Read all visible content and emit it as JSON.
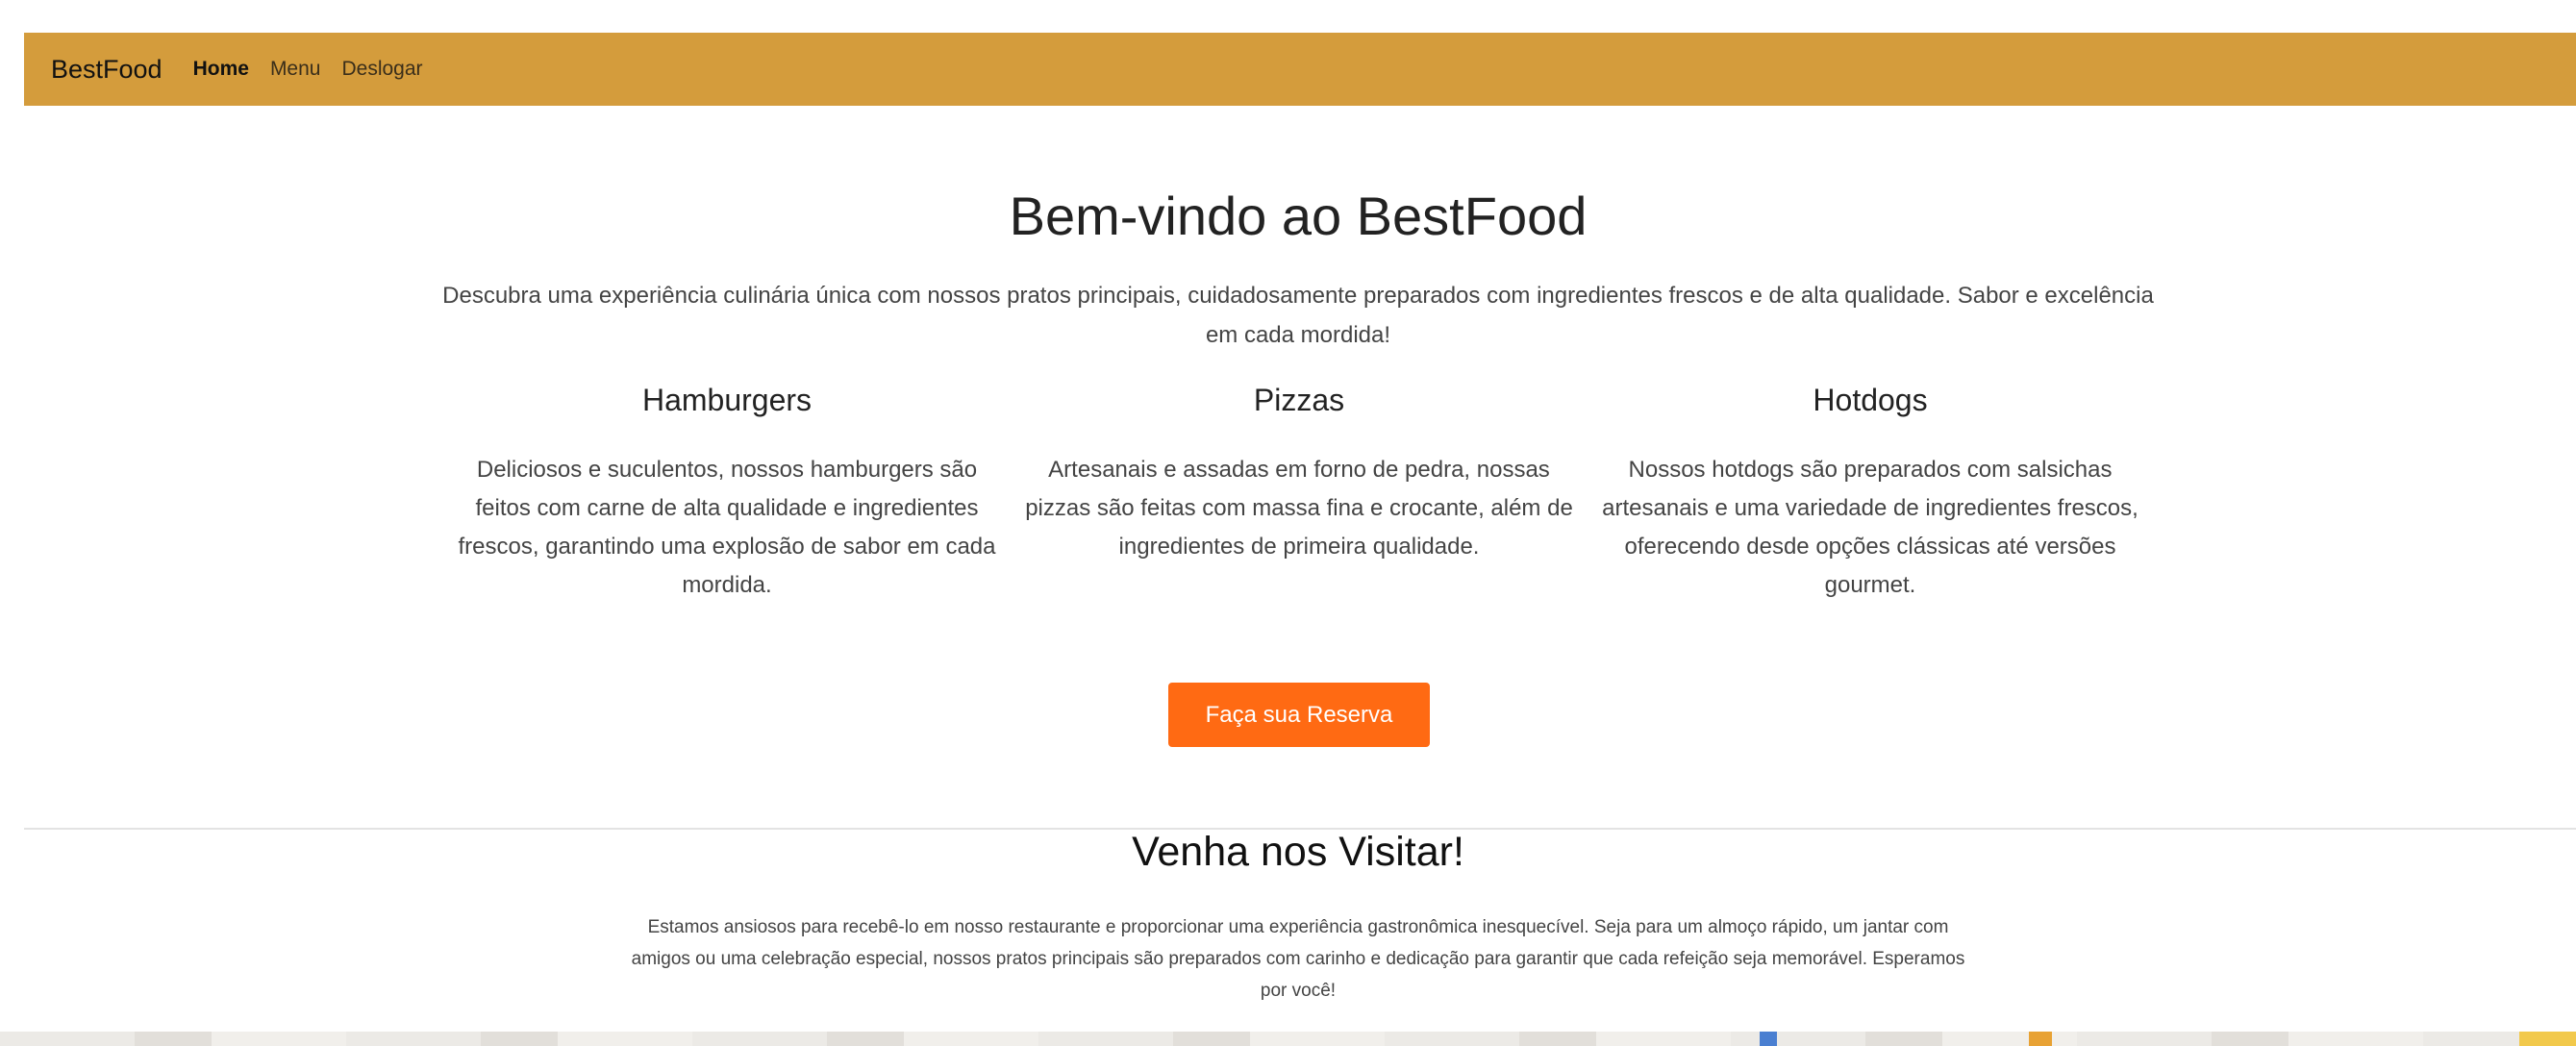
{
  "navbar": {
    "brand": "BestFood",
    "links": [
      {
        "label": "Home",
        "active": true
      },
      {
        "label": "Menu",
        "active": false
      },
      {
        "label": "Deslogar",
        "active": false
      }
    ],
    "background": "#d49c3c"
  },
  "hero": {
    "title": "Bem-vindo ao BestFood",
    "description": "Descubra uma experiência culinária única com nossos pratos principais, cuidadosamente preparados com ingredientes frescos e de alta qualidade. Sabor e excelência em cada mordida!"
  },
  "features": [
    {
      "title": "Hamburgers",
      "text": "Deliciosos e suculentos, nossos hamburgers são feitos com carne de alta qualidade e ingredientes frescos, garantindo uma explosão de sabor em cada mordida."
    },
    {
      "title": "Pizzas",
      "text": "Artesanais e assadas em forno de pedra, nossas pizzas são feitas com massa fina e crocante, além de ingredientes de primeira qualidade."
    },
    {
      "title": "Hotdogs",
      "text": "Nossos hotdogs são preparados com salsichas artesanais e uma variedade de ingredientes frescos, oferecendo desde opções clássicas até versões gourmet."
    }
  ],
  "cta": {
    "label": "Faça sua Reserva",
    "color": "#ff6a13"
  },
  "visit": {
    "title": "Venha nos Visitar!",
    "text": "Estamos ansiosos para recebê-lo em nosso restaurante e proporcionar uma experiência gastronômica inesquecível. Seja para um almoço rápido, um jantar com amigos ou uma celebração especial, nossos pratos principais são preparados com carinho e dedicação para garantir que cada refeição seja memorável. Esperamos por você!"
  }
}
